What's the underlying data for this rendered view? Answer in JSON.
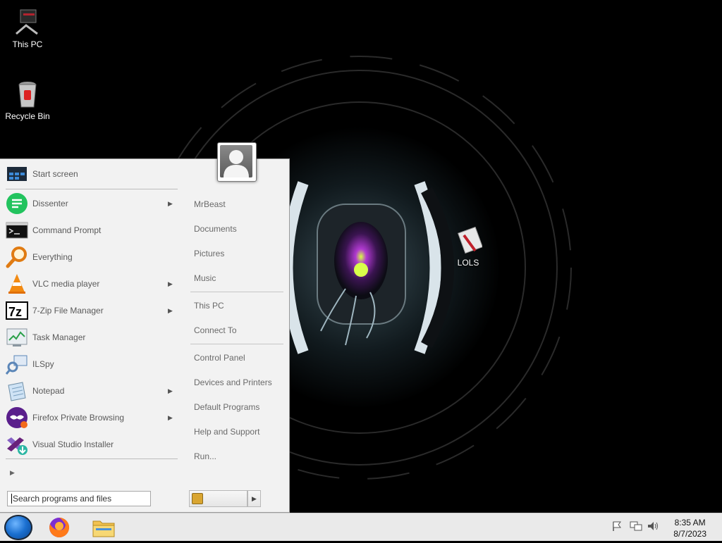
{
  "desktop": {
    "icons": [
      {
        "label": "This PC",
        "icon": "computer-icon"
      },
      {
        "label": "Recycle Bin",
        "icon": "recycle-bin-icon"
      },
      {
        "label": "LOLS",
        "icon": "file-icon"
      }
    ]
  },
  "start_menu": {
    "programs": [
      {
        "label": "Start screen",
        "icon": "start-screen-icon",
        "has_submenu": false
      },
      {
        "label": "Dissenter",
        "icon": "dissenter-icon",
        "has_submenu": true
      },
      {
        "label": "Command Prompt",
        "icon": "command-prompt-icon",
        "has_submenu": false
      },
      {
        "label": "Everything",
        "icon": "everything-search-icon",
        "has_submenu": false
      },
      {
        "label": "VLC media player",
        "icon": "vlc-cone-icon",
        "has_submenu": true
      },
      {
        "label": "7-Zip File Manager",
        "icon": "7zip-icon",
        "has_submenu": true
      },
      {
        "label": "Task Manager",
        "icon": "task-manager-icon",
        "has_submenu": false
      },
      {
        "label": "ILSpy",
        "icon": "ilspy-icon",
        "has_submenu": false
      },
      {
        "label": "Notepad",
        "icon": "notepad-icon",
        "has_submenu": true
      },
      {
        "label": "Firefox Private Browsing",
        "icon": "firefox-private-icon",
        "has_submenu": true
      },
      {
        "label": "Visual Studio Installer",
        "icon": "visual-studio-installer-icon",
        "has_submenu": false
      }
    ],
    "search_placeholder": "Search programs and files",
    "submenu_arrow": "▶",
    "right_links": {
      "user": "MrBeast",
      "documents": "Documents",
      "pictures": "Pictures",
      "music": "Music",
      "this_pc": "This PC",
      "connect_to": "Connect To",
      "control_panel": "Control Panel",
      "devices_printers": "Devices and Printers",
      "default_programs": "Default Programs",
      "help_support": "Help and Support",
      "run": "Run..."
    }
  },
  "taskbar": {
    "apps": [
      {
        "icon": "firefox-icon"
      },
      {
        "icon": "file-explorer-icon"
      }
    ],
    "tray_icons": [
      "flag-icon",
      "network-icon",
      "volume-icon"
    ],
    "clock": {
      "time": "8:35 AM",
      "date": "8/7/2023"
    }
  }
}
